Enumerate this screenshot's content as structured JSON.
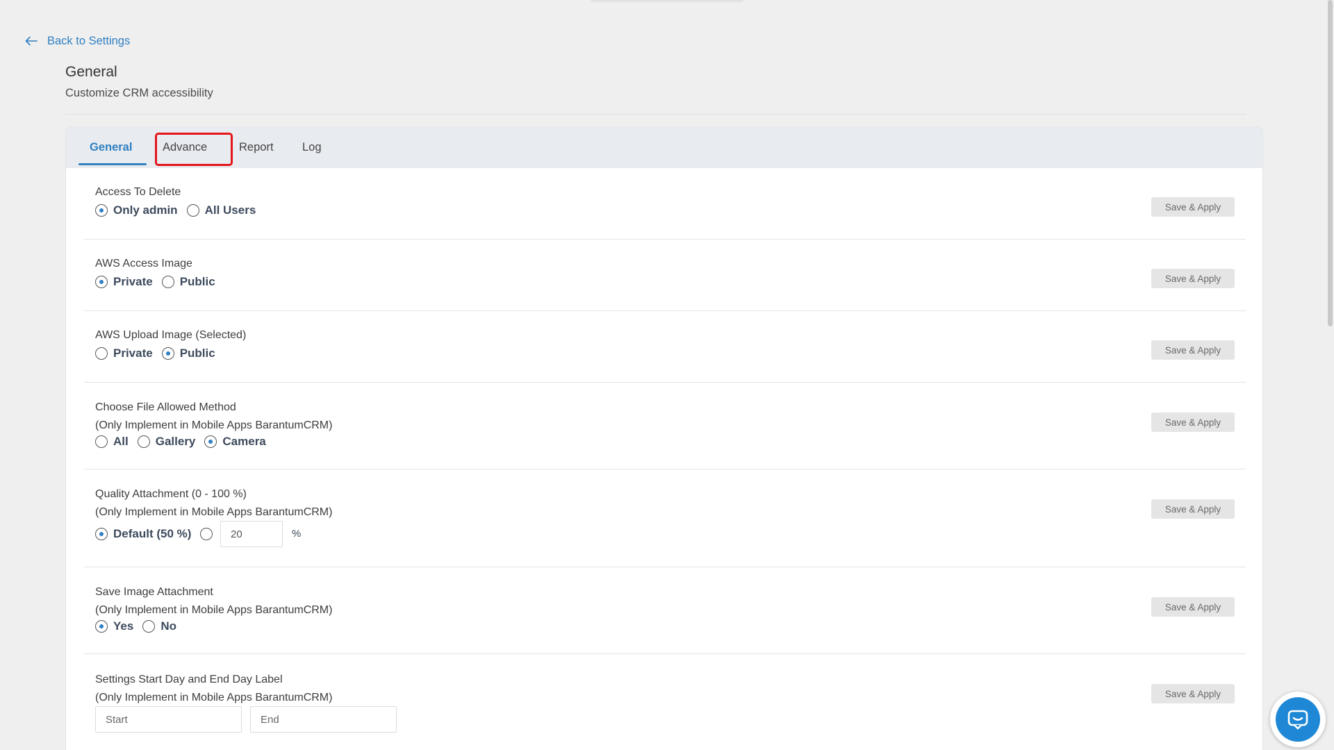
{
  "nav": {
    "back_label": "Back to Settings"
  },
  "header": {
    "title": "General",
    "subtitle": "Customize CRM accessibility"
  },
  "tabs": [
    {
      "label": "General",
      "active": true
    },
    {
      "label": "Advance",
      "active": false,
      "highlighted": true
    },
    {
      "label": "Report",
      "active": false
    },
    {
      "label": "Log",
      "active": false
    }
  ],
  "save_label": "Save & Apply",
  "sections": {
    "access_delete": {
      "label": "Access To Delete",
      "options": [
        {
          "label": "Only admin",
          "checked": true
        },
        {
          "label": "All Users",
          "checked": false
        }
      ]
    },
    "aws_access_image": {
      "label": "AWS Access Image",
      "options": [
        {
          "label": "Private",
          "checked": true
        },
        {
          "label": "Public",
          "checked": false
        }
      ]
    },
    "aws_upload_image": {
      "label": "AWS Upload Image (Selected)",
      "options": [
        {
          "label": "Private",
          "checked": false
        },
        {
          "label": "Public",
          "checked": true
        }
      ]
    },
    "file_method": {
      "label": "Choose File Allowed Method",
      "note": "(Only Implement in Mobile Apps BarantumCRM)",
      "options": [
        {
          "label": "All",
          "checked": false
        },
        {
          "label": "Gallery",
          "checked": false
        },
        {
          "label": "Camera",
          "checked": true
        }
      ]
    },
    "quality_attachment": {
      "label": "Quality Attachment (0 - 100 %)",
      "note": "(Only Implement in Mobile Apps BarantumCRM)",
      "default_label": "Default (50 %)",
      "default_checked": true,
      "custom_checked": false,
      "custom_value": "20",
      "unit": "%"
    },
    "save_image": {
      "label": "Save Image Attachment",
      "note": "(Only Implement in Mobile Apps BarantumCRM)",
      "options": [
        {
          "label": "Yes",
          "checked": true
        },
        {
          "label": "No",
          "checked": false
        }
      ]
    },
    "day_label": {
      "label": "Settings Start Day and End Day Label",
      "note": "(Only Implement in Mobile Apps BarantumCRM)",
      "start_placeholder": "Start",
      "end_placeholder": "End"
    }
  },
  "colors": {
    "accent": "#2f7fc1",
    "highlight": "#e4141b",
    "chat": "#1e88d6"
  },
  "icons": {
    "back": "arrow-left-icon",
    "chat": "chat-bubble-icon"
  }
}
